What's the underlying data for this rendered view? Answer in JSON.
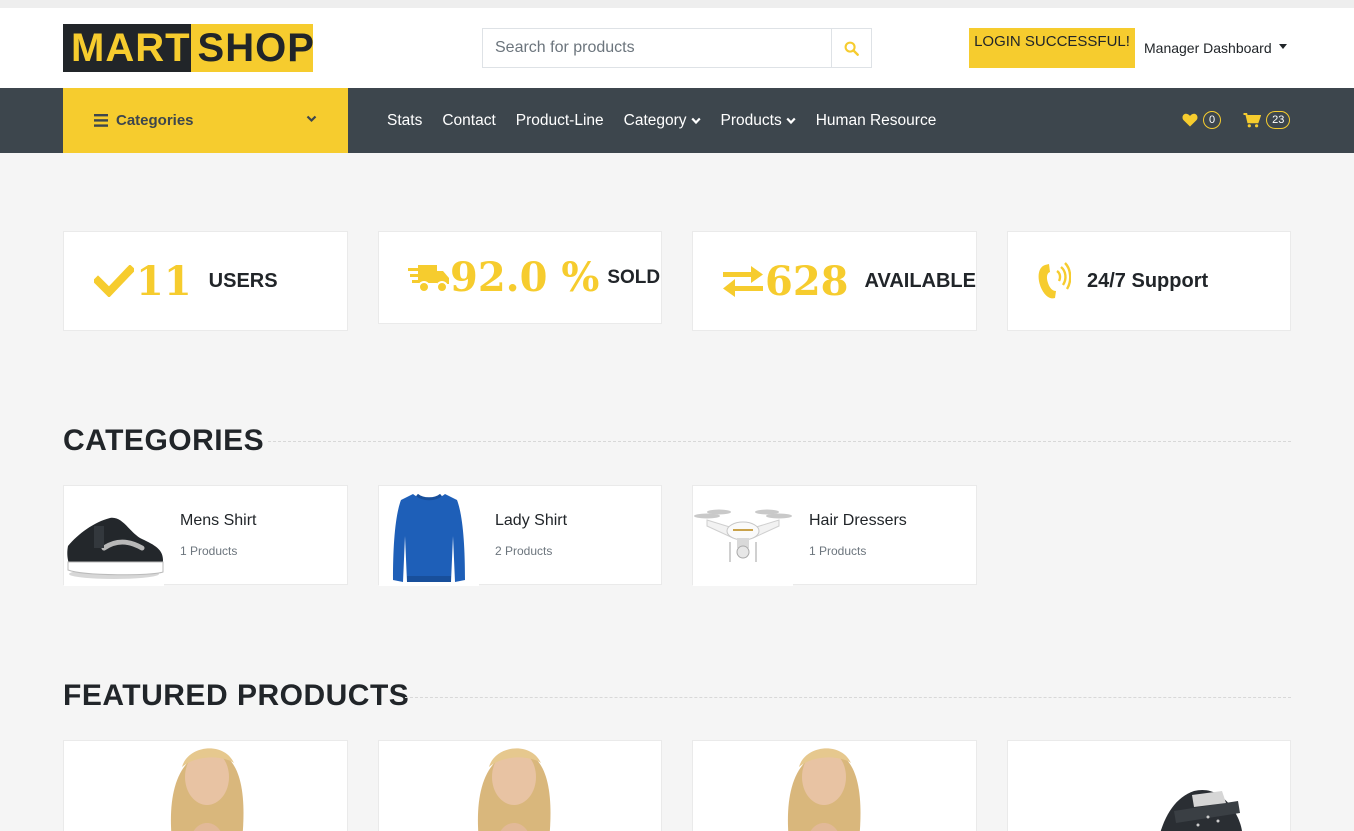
{
  "brand": {
    "part1": "MART",
    "part2": "SHOP"
  },
  "search": {
    "placeholder": "Search for products",
    "icon": "search-icon"
  },
  "header": {
    "login_status": "LOGIN SUCCESSFUL!",
    "manager_menu": "Manager Dashboard"
  },
  "nav": {
    "categories_label": "Categories",
    "links": [
      "Stats",
      "Contact",
      "Product-Line",
      "Category",
      "Products",
      "Human Resource"
    ],
    "wishlist_count": "0",
    "cart_count": "23"
  },
  "stats": [
    {
      "icon": "check-icon",
      "value": "11",
      "label": "USERS"
    },
    {
      "icon": "truck-icon",
      "value": "92.0 %",
      "label": "SOLD"
    },
    {
      "icon": "exchange-icon",
      "value": "628",
      "label": "AVAILABLE"
    },
    {
      "icon": "phone-volume-icon",
      "value": "",
      "label": "24/7 Support"
    }
  ],
  "categories_section": {
    "title": "CATEGORIES",
    "items": [
      {
        "name": "Mens Shirt",
        "count": "1 Products",
        "image": "sneaker"
      },
      {
        "name": "Lady Shirt",
        "count": "2 Products",
        "image": "blue-sweater"
      },
      {
        "name": "Hair Dressers",
        "count": "1 Products",
        "image": "drone"
      }
    ]
  },
  "featured_section": {
    "title": "FEATURED PRODUCTS",
    "items": [
      {
        "image": "model-photo"
      },
      {
        "image": "model-photo"
      },
      {
        "image": "model-photo"
      },
      {
        "image": "sneaker"
      }
    ]
  },
  "colors": {
    "accent": "#f6cc2e",
    "dark": "#3d464d",
    "text": "#212529"
  }
}
